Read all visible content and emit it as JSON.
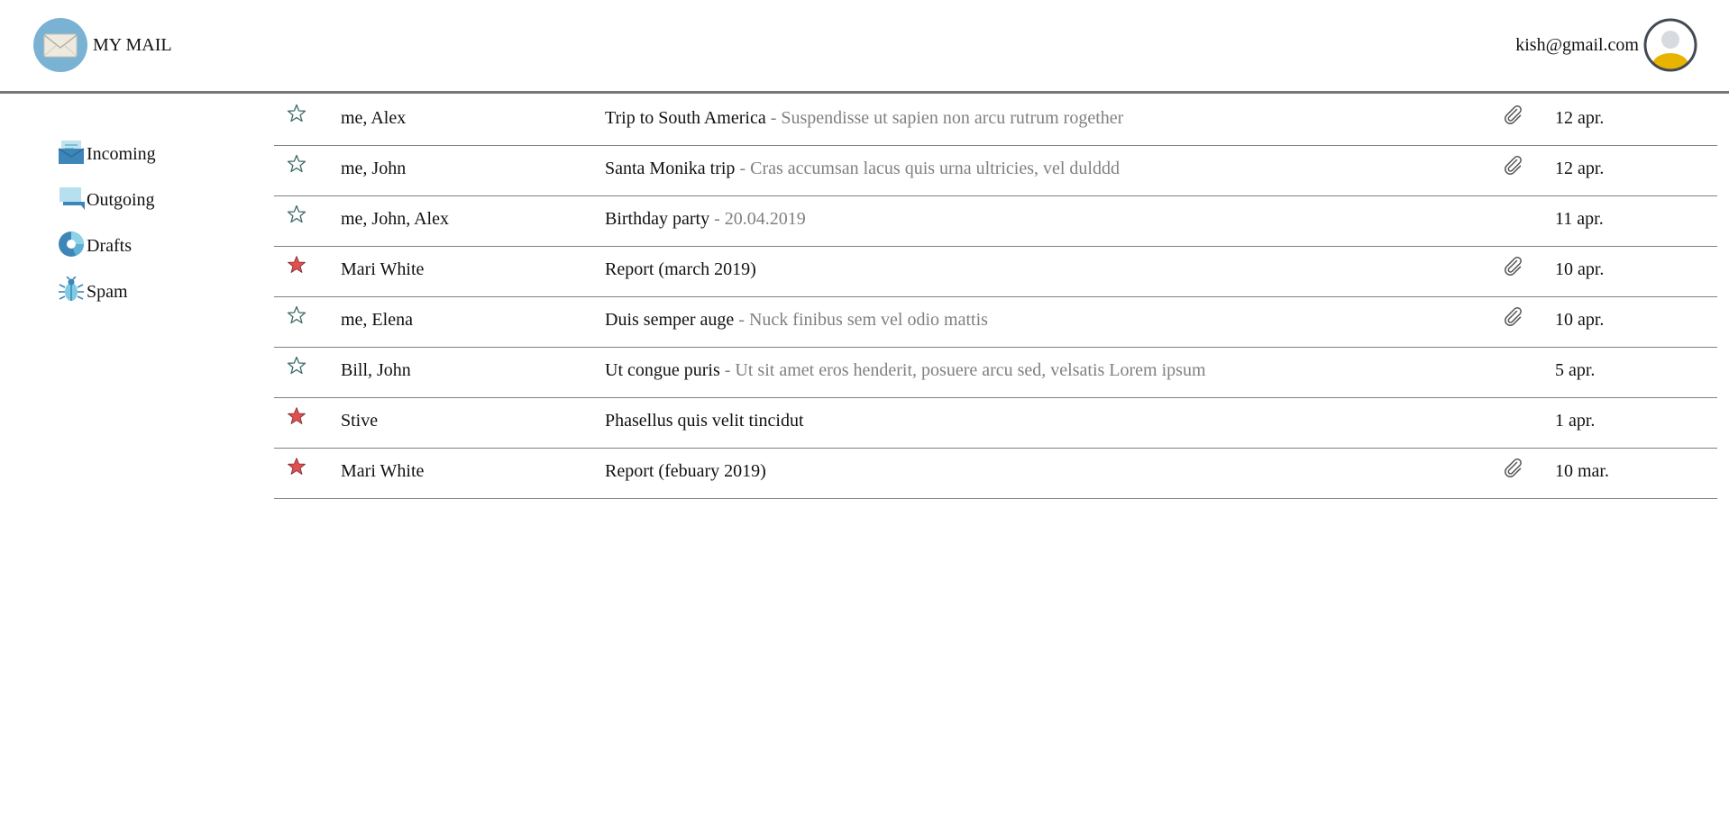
{
  "header": {
    "app_title": "MY MAIL",
    "user_email": "kish@gmail.com",
    "logo_icon": "envelope-icon",
    "avatar_icon": "user-avatar-icon"
  },
  "sidebar": {
    "items": [
      {
        "label": "Incoming",
        "icon": "inbox-icon"
      },
      {
        "label": "Outgoing",
        "icon": "outbox-icon"
      },
      {
        "label": "Drafts",
        "icon": "drafts-icon"
      },
      {
        "label": "Spam",
        "icon": "spam-bug-icon"
      }
    ]
  },
  "colors": {
    "star_active": "#e05050",
    "star_inactive_stroke": "#3d6b66",
    "preview_text": "#808080",
    "divider": "#808080",
    "header_border": "#777777",
    "logo_bg": "#79b2d3",
    "avatar_accent": "#e8b400"
  },
  "emails": [
    {
      "starred": false,
      "sender": "me, Alex",
      "subject": "Trip to South America",
      "preview": " - Suspendisse ut sapien non arcu rutrum rogether",
      "attachment": true,
      "date": "12 apr."
    },
    {
      "starred": false,
      "sender": "me, John",
      "subject": "Santa Monika trip",
      "preview": " - Cras accumsan lacus quis urna ultricies, vel dulddd",
      "attachment": true,
      "date": "12 apr."
    },
    {
      "starred": false,
      "sender": "me, John, Alex",
      "subject": "Birthday party",
      "preview": " - 20.04.2019",
      "attachment": false,
      "date": "11 apr."
    },
    {
      "starred": true,
      "sender": "Mari White",
      "subject": "Report (march 2019)",
      "preview": "",
      "attachment": true,
      "date": "10 apr."
    },
    {
      "starred": false,
      "sender": "me, Elena",
      "subject": "Duis semper auge",
      "preview": " - Nuck finibus sem vel odio mattis",
      "attachment": true,
      "date": "10 apr."
    },
    {
      "starred": false,
      "sender": "Bill, John",
      "subject": "Ut congue puris",
      "preview": " - Ut sit amet eros henderit, posuere arcu sed, velsatis Lorem ipsum",
      "attachment": false,
      "date": "5 apr."
    },
    {
      "starred": true,
      "sender": "Stive",
      "subject": "Phasellus quis velit tincidut",
      "preview": "",
      "attachment": false,
      "date": "1 apr."
    },
    {
      "starred": true,
      "sender": "Mari White",
      "subject": "Report (febuary 2019)",
      "preview": "",
      "attachment": true,
      "date": "10 mar."
    }
  ]
}
